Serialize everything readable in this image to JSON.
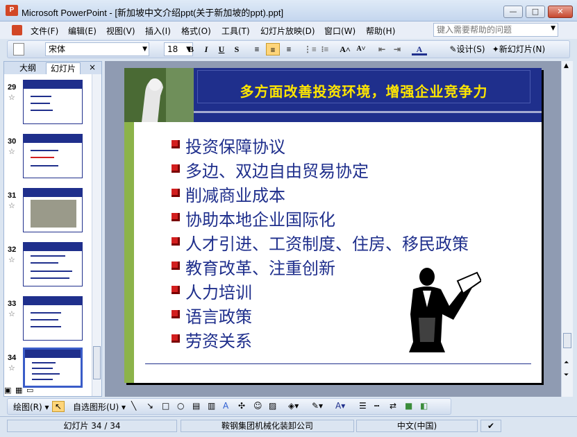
{
  "window": {
    "title": "Microsoft PowerPoint - [新加坡中文介绍ppt(关于新加坡的ppt).ppt]",
    "minimize": "—",
    "maximize": "□",
    "close": "✕"
  },
  "menu": {
    "items": [
      "文件(F)",
      "编辑(E)",
      "视图(V)",
      "插入(I)",
      "格式(O)",
      "工具(T)",
      "幻灯片放映(D)",
      "窗口(W)",
      "帮助(H)"
    ],
    "help_placeholder": "键入需要帮助的问题"
  },
  "toolbar": {
    "font_name": "宋体",
    "font_size": "18",
    "bold": "B",
    "italic": "I",
    "underline": "U",
    "shadow": "S",
    "design_label": "设计(S)",
    "new_slide_label": "新幻灯片(N)"
  },
  "left_panel": {
    "tab_outline": "大纲",
    "tab_slides": "幻灯片",
    "close": "×",
    "slides": [
      {
        "number": "29"
      },
      {
        "number": "30"
      },
      {
        "number": "31"
      },
      {
        "number": "32"
      },
      {
        "number": "33"
      },
      {
        "number": "34"
      }
    ]
  },
  "slide": {
    "title": "多方面改善投资环境，增强企业竞争力",
    "bullets": [
      "投资保障协议",
      "多边、双边自由贸易协定",
      "削减商业成本",
      "协助本地企业国际化",
      "人才引进、工资制度、住房、移民政策",
      "教育改革、注重创新",
      "人力培训",
      "语言政策",
      "劳资关系"
    ],
    "colors": {
      "band": "#1f2f8c",
      "title": "#ffe600",
      "bullet_text": "#1f2f8c",
      "bullet_mark": "#d21e1e",
      "side_bar": "#8cb34a"
    }
  },
  "drawing_toolbar": {
    "draw_label": "绘图(R)",
    "autoshapes_label": "自选图形(U)"
  },
  "status": {
    "slide_position": "幻灯片 34 / 34",
    "design_name": "鞍钢集团机械化装卸公司",
    "language": "中文(中国)"
  }
}
